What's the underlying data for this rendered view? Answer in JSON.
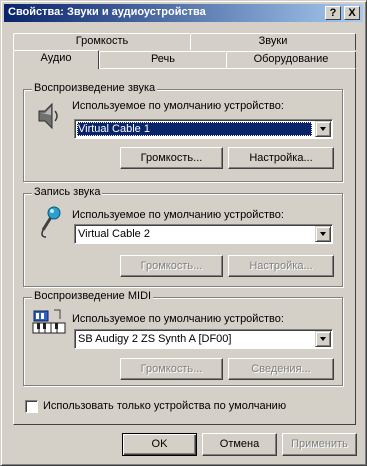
{
  "window": {
    "title": "Свойства: Звуки и аудиоустройства",
    "help_label": "?",
    "close_label": "X"
  },
  "tabs": {
    "row_top": [
      "Громкость",
      "Звуки"
    ],
    "row_bottom": [
      "Аудио",
      "Речь",
      "Оборудование"
    ],
    "active": "Аудио"
  },
  "playback": {
    "title": "Воспроизведение звука",
    "device_label": "Используемое по умолчанию устройство:",
    "device_value": "Virtual Cable 1",
    "volume_button": "Громкость...",
    "settings_button": "Настройка...",
    "icon": "speaker-icon"
  },
  "recording": {
    "title": "Запись звука",
    "device_label": "Используемое по умолчанию устройство:",
    "device_value": "Virtual Cable 2",
    "volume_button": "Громкость...",
    "settings_button": "Настройка...",
    "icon": "microphone-icon"
  },
  "midi": {
    "title": "Воспроизведение MIDI",
    "device_label": "Используемое по умолчанию устройство:",
    "device_value": "SB Audigy 2 ZS Synth A [DF00]",
    "volume_button": "Громкость...",
    "info_button": "Сведения...",
    "icon": "midi-keyboard-icon"
  },
  "only_default_checkbox": {
    "label": "Использовать только устройства по умолчанию",
    "checked": false
  },
  "footer": {
    "ok": "OK",
    "cancel": "Отмена",
    "apply": "Применить"
  }
}
